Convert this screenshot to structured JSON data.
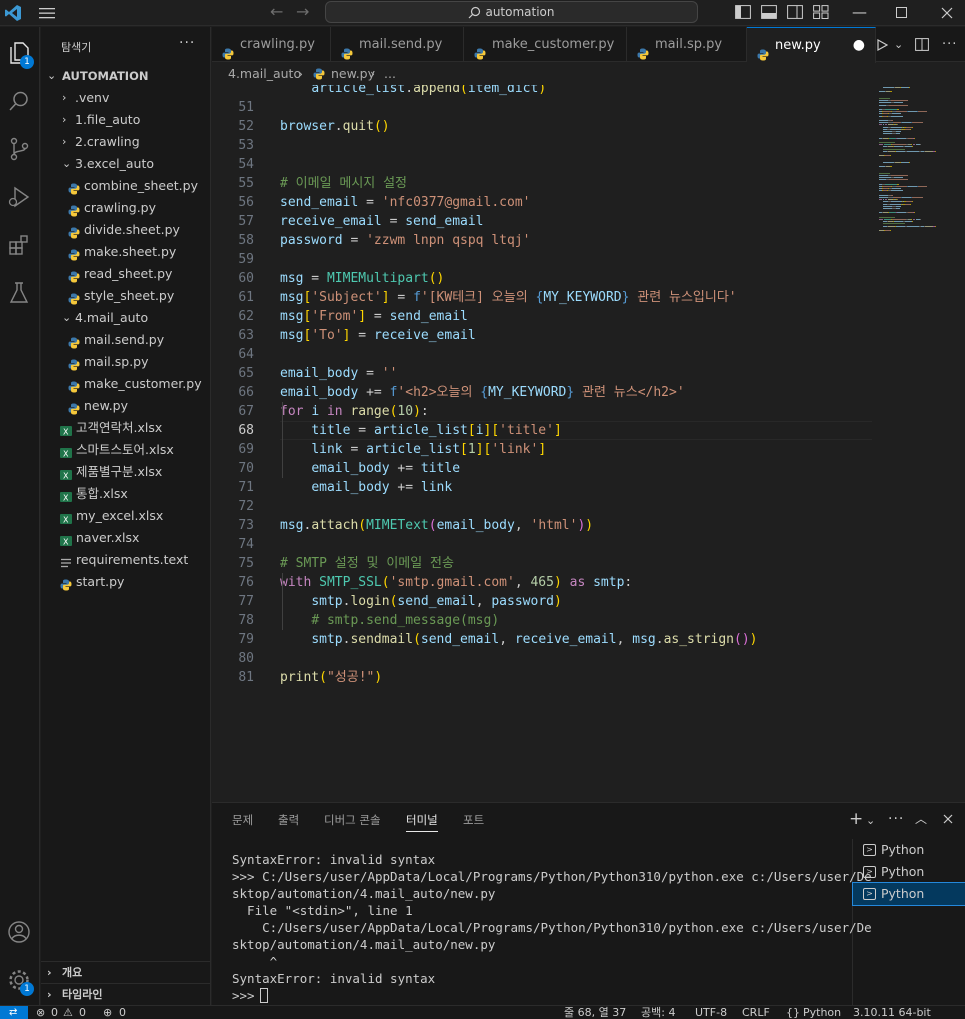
{
  "titlebar": {
    "search_text": "automation",
    "icons": [
      "vscode-logo-icon",
      "menu-icon",
      "back-arrow-icon",
      "forward-arrow-icon",
      "search-icon",
      "toggle-sidebar-icon",
      "toggle-panel-icon",
      "toggle-secondary-sidebar-icon",
      "customize-layout-icon",
      "minimize-icon",
      "maximize-icon",
      "close-icon"
    ]
  },
  "activity_bar": {
    "items": [
      "explorer-icon",
      "search-icon",
      "source-control-icon",
      "run-debug-icon",
      "extensions-icon",
      "testing-icon",
      "account-icon",
      "manage-gear-icon"
    ],
    "explorer_badge": "1",
    "manage_badge": "1"
  },
  "sidebar": {
    "title": "탐색기",
    "more": "···",
    "root": "AUTOMATION",
    "items": [
      {
        "label": ".venv",
        "type": "folder",
        "indent": 1,
        "open": false
      },
      {
        "label": "1.file_auto",
        "type": "folder",
        "indent": 1,
        "open": false
      },
      {
        "label": "2.crawling",
        "type": "folder",
        "indent": 1,
        "open": false
      },
      {
        "label": "3.excel_auto",
        "type": "folder",
        "indent": 1,
        "open": true
      },
      {
        "label": "combine_sheet.py",
        "type": "py",
        "indent": 2
      },
      {
        "label": "crawling.py",
        "type": "py",
        "indent": 2
      },
      {
        "label": "divide.sheet.py",
        "type": "py",
        "indent": 2
      },
      {
        "label": "make.sheet.py",
        "type": "py",
        "indent": 2
      },
      {
        "label": "read_sheet.py",
        "type": "py",
        "indent": 2
      },
      {
        "label": "style_sheet.py",
        "type": "py",
        "indent": 2
      },
      {
        "label": "4.mail_auto",
        "type": "folder",
        "indent": 1,
        "open": true
      },
      {
        "label": "mail.send.py",
        "type": "py",
        "indent": 2
      },
      {
        "label": "mail.sp.py",
        "type": "py",
        "indent": 2
      },
      {
        "label": "make_customer.py",
        "type": "py",
        "indent": 2
      },
      {
        "label": "new.py",
        "type": "py",
        "indent": 2
      },
      {
        "label": "고객연락처.xlsx",
        "type": "xlsx",
        "indent": 1
      },
      {
        "label": "스마트스토어.xlsx",
        "type": "xlsx",
        "indent": 1
      },
      {
        "label": "제품별구분.xlsx",
        "type": "xlsx",
        "indent": 1
      },
      {
        "label": "통합.xlsx",
        "type": "xlsx",
        "indent": 1
      },
      {
        "label": "my_excel.xlsx",
        "type": "xlsx",
        "indent": 1
      },
      {
        "label": "naver.xlsx",
        "type": "xlsx",
        "indent": 1
      },
      {
        "label": "requirements.text",
        "type": "txt",
        "indent": 1
      },
      {
        "label": "start.py",
        "type": "py",
        "indent": 1
      }
    ],
    "outline": "개요",
    "timeline": "타임라인"
  },
  "tabs": [
    {
      "label": "crawling.py",
      "active": false
    },
    {
      "label": "mail.send.py",
      "active": false
    },
    {
      "label": "make_customer.py",
      "active": false
    },
    {
      "label": "mail.sp.py",
      "active": false
    },
    {
      "label": "new.py",
      "active": true,
      "dirty": true
    }
  ],
  "breadcrumb": {
    "folder": "4.mail_auto",
    "file": "new.py",
    "tail": "..."
  },
  "editor": {
    "current_line": 68,
    "lines": [
      {
        "n": "",
        "segs": [
          [
            "pl",
            "    "
          ],
          [
            "var",
            "article_list"
          ],
          [
            "pl",
            "."
          ],
          [
            "fn",
            "append"
          ],
          [
            "br1",
            "("
          ],
          [
            "var",
            "item_dict"
          ],
          [
            "br1",
            ")"
          ]
        ]
      },
      {
        "n": "51",
        "segs": []
      },
      {
        "n": "52",
        "segs": [
          [
            "var",
            "browser"
          ],
          [
            "pl",
            "."
          ],
          [
            "fn",
            "quit"
          ],
          [
            "br1",
            "()"
          ]
        ]
      },
      {
        "n": "53",
        "segs": []
      },
      {
        "n": "54",
        "segs": []
      },
      {
        "n": "55",
        "segs": [
          [
            "com",
            "# 이메일 메시지 설정"
          ]
        ]
      },
      {
        "n": "56",
        "segs": [
          [
            "var",
            "send_email"
          ],
          [
            "pl",
            " = "
          ],
          [
            "str",
            "'nfc0377@gmail.com'"
          ]
        ]
      },
      {
        "n": "57",
        "segs": [
          [
            "var",
            "receive_email"
          ],
          [
            "pl",
            " = "
          ],
          [
            "var",
            "send_email"
          ]
        ]
      },
      {
        "n": "58",
        "segs": [
          [
            "var",
            "password"
          ],
          [
            "pl",
            " = "
          ],
          [
            "str",
            "'zzwm lnpn qspq ltqj'"
          ]
        ]
      },
      {
        "n": "59",
        "segs": []
      },
      {
        "n": "60",
        "segs": [
          [
            "var",
            "msg"
          ],
          [
            "pl",
            " = "
          ],
          [
            "cls",
            "MIMEMultipart"
          ],
          [
            "br1",
            "()"
          ]
        ]
      },
      {
        "n": "61",
        "segs": [
          [
            "var",
            "msg"
          ],
          [
            "br1",
            "["
          ],
          [
            "str",
            "'Subject'"
          ],
          [
            "br1",
            "]"
          ],
          [
            "pl",
            " = "
          ],
          [
            "kb",
            "f"
          ],
          [
            "str",
            "'[KW테크] 오늘의 "
          ],
          [
            "fmt",
            "{"
          ],
          [
            "var",
            "MY_KEYWORD"
          ],
          [
            "fmt",
            "}"
          ],
          [
            "str",
            " 관련 뉴스입니다'"
          ]
        ]
      },
      {
        "n": "62",
        "segs": [
          [
            "var",
            "msg"
          ],
          [
            "br1",
            "["
          ],
          [
            "str",
            "'From'"
          ],
          [
            "br1",
            "]"
          ],
          [
            "pl",
            " = "
          ],
          [
            "var",
            "send_email"
          ]
        ]
      },
      {
        "n": "63",
        "segs": [
          [
            "var",
            "msg"
          ],
          [
            "br1",
            "["
          ],
          [
            "str",
            "'To'"
          ],
          [
            "br1",
            "]"
          ],
          [
            "pl",
            " = "
          ],
          [
            "var",
            "receive_email"
          ]
        ]
      },
      {
        "n": "64",
        "segs": []
      },
      {
        "n": "65",
        "segs": [
          [
            "var",
            "email_body"
          ],
          [
            "pl",
            " = "
          ],
          [
            "str",
            "''"
          ]
        ]
      },
      {
        "n": "66",
        "segs": [
          [
            "var",
            "email_body"
          ],
          [
            "pl",
            " += "
          ],
          [
            "kb",
            "f"
          ],
          [
            "str",
            "'<h2>오늘의 "
          ],
          [
            "fmt",
            "{"
          ],
          [
            "var",
            "MY_KEYWORD"
          ],
          [
            "fmt",
            "}"
          ],
          [
            "str",
            " 관련 뉴스</h2>'"
          ]
        ]
      },
      {
        "n": "67",
        "segs": [
          [
            "kw",
            "for"
          ],
          [
            "pl",
            " "
          ],
          [
            "var",
            "i"
          ],
          [
            "pl",
            " "
          ],
          [
            "kw",
            "in"
          ],
          [
            "pl",
            " "
          ],
          [
            "fn",
            "range"
          ],
          [
            "br1",
            "("
          ],
          [
            "num",
            "10"
          ],
          [
            "br1",
            ")"
          ],
          [
            "pl",
            ":"
          ]
        ]
      },
      {
        "n": "68",
        "segs": [
          [
            "pl",
            "    "
          ],
          [
            "var",
            "title"
          ],
          [
            "pl",
            " = "
          ],
          [
            "var",
            "article_list"
          ],
          [
            "br1",
            "["
          ],
          [
            "var",
            "i"
          ],
          [
            "br1",
            "]"
          ],
          [
            "br1",
            "["
          ],
          [
            "str",
            "'title'"
          ],
          [
            "br1",
            "]"
          ]
        ]
      },
      {
        "n": "69",
        "segs": [
          [
            "pl",
            "    "
          ],
          [
            "var",
            "link"
          ],
          [
            "pl",
            " = "
          ],
          [
            "var",
            "article_list"
          ],
          [
            "br1",
            "["
          ],
          [
            "num",
            "1"
          ],
          [
            "br1",
            "]"
          ],
          [
            "br1",
            "["
          ],
          [
            "str",
            "'link'"
          ],
          [
            "br1",
            "]"
          ]
        ]
      },
      {
        "n": "70",
        "segs": [
          [
            "pl",
            "    "
          ],
          [
            "var",
            "email_body"
          ],
          [
            "pl",
            " += "
          ],
          [
            "var",
            "title"
          ]
        ]
      },
      {
        "n": "71",
        "segs": [
          [
            "pl",
            "    "
          ],
          [
            "var",
            "email_body"
          ],
          [
            "pl",
            " += "
          ],
          [
            "var",
            "link"
          ]
        ]
      },
      {
        "n": "72",
        "segs": []
      },
      {
        "n": "73",
        "segs": [
          [
            "var",
            "msg"
          ],
          [
            "pl",
            "."
          ],
          [
            "fn",
            "attach"
          ],
          [
            "br1",
            "("
          ],
          [
            "cls",
            "MIMEText"
          ],
          [
            "br2",
            "("
          ],
          [
            "var",
            "email_body"
          ],
          [
            "pl",
            ", "
          ],
          [
            "str",
            "'html'"
          ],
          [
            "br2",
            ")"
          ],
          [
            "br1",
            ")"
          ]
        ]
      },
      {
        "n": "74",
        "segs": []
      },
      {
        "n": "75",
        "segs": [
          [
            "com",
            "# SMTP 설정 및 이메일 전송"
          ]
        ]
      },
      {
        "n": "76",
        "segs": [
          [
            "kw",
            "with"
          ],
          [
            "pl",
            " "
          ],
          [
            "cls",
            "SMTP_SSL"
          ],
          [
            "br1",
            "("
          ],
          [
            "str",
            "'smtp.gmail.com'"
          ],
          [
            "pl",
            ", "
          ],
          [
            "num",
            "465"
          ],
          [
            "br1",
            ")"
          ],
          [
            "pl",
            " "
          ],
          [
            "kw",
            "as"
          ],
          [
            "pl",
            " "
          ],
          [
            "var",
            "smtp"
          ],
          [
            "pl",
            ":"
          ]
        ]
      },
      {
        "n": "77",
        "segs": [
          [
            "pl",
            "    "
          ],
          [
            "var",
            "smtp"
          ],
          [
            "pl",
            "."
          ],
          [
            "fn",
            "login"
          ],
          [
            "br1",
            "("
          ],
          [
            "var",
            "send_email"
          ],
          [
            "pl",
            ", "
          ],
          [
            "var",
            "password"
          ],
          [
            "br1",
            ")"
          ]
        ]
      },
      {
        "n": "78",
        "segs": [
          [
            "pl",
            "    "
          ],
          [
            "com",
            "# smtp.send_message(msg)"
          ]
        ]
      },
      {
        "n": "79",
        "segs": [
          [
            "pl",
            "    "
          ],
          [
            "var",
            "smtp"
          ],
          [
            "pl",
            "."
          ],
          [
            "fn",
            "sendmail"
          ],
          [
            "br1",
            "("
          ],
          [
            "var",
            "send_email"
          ],
          [
            "pl",
            ", "
          ],
          [
            "var",
            "receive_email"
          ],
          [
            "pl",
            ", "
          ],
          [
            "var",
            "msg"
          ],
          [
            "pl",
            "."
          ],
          [
            "fn",
            "as_strign"
          ],
          [
            "br2",
            "()"
          ],
          [
            "br1",
            ")"
          ]
        ]
      },
      {
        "n": "80",
        "segs": []
      },
      {
        "n": "81",
        "segs": [
          [
            "fn",
            "print"
          ],
          [
            "br1",
            "("
          ],
          [
            "str",
            "\"성공!\""
          ],
          [
            "br1",
            ")"
          ]
        ]
      }
    ]
  },
  "panel": {
    "tabs": [
      {
        "label": "문제",
        "active": false
      },
      {
        "label": "출력",
        "active": false
      },
      {
        "label": "디버그 콘솔",
        "active": false
      },
      {
        "label": "터미널",
        "active": true
      },
      {
        "label": "포트",
        "active": false
      }
    ],
    "actions": [
      "new-terminal-icon",
      "dropdown-icon",
      "more-icon",
      "maximize-panel-icon",
      "close-panel-icon"
    ],
    "terminal_lines": [
      "SyntaxError: invalid syntax",
      ">>> C:/Users/user/AppData/Local/Programs/Python/Python310/python.exe c:/Users/user/De",
      "sktop/automation/4.mail_auto/new.py",
      "  File \"<stdin>\", line 1",
      "    C:/Users/user/AppData/Local/Programs/Python/Python310/python.exe c:/Users/user/De",
      "sktop/automation/4.mail_auto/new.py",
      "     ^",
      "SyntaxError: invalid syntax",
      ">>> "
    ],
    "terminals": [
      {
        "label": "Python",
        "selected": false
      },
      {
        "label": "Python",
        "selected": false
      },
      {
        "label": "Python",
        "selected": true
      }
    ]
  },
  "statusbar": {
    "errors": "0",
    "warnings": "0",
    "ports": "0",
    "position": "줄 68, 열 37",
    "spaces": "공백: 4",
    "encoding": "UTF-8",
    "eol": "CRLF",
    "language": "Python",
    "interpreter": "3.10.11 64-bit"
  },
  "colors": {
    "accent": "#0078d4",
    "editor_bg": "#1f1f1f",
    "sidebar_bg": "#181818"
  }
}
